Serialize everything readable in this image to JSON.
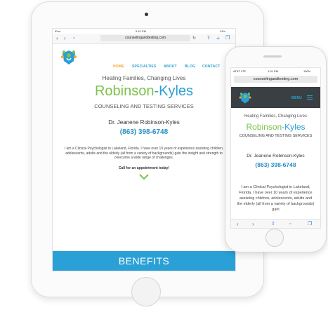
{
  "colors": {
    "green": "#7cc24a",
    "blue": "#2a9fd3",
    "nav_active": "#f3a533",
    "benefits_bg": "#2aa0d6",
    "phone_nav_bg": "#3a3f44"
  },
  "tablet": {
    "status": {
      "carrier": "iPad",
      "time": "5:10 PM",
      "battery": "34%"
    },
    "url": "counselingandtesting.com",
    "nav": [
      "HOME",
      "SPECIALTIES",
      "ABOUT",
      "BLOG",
      "CONTACT"
    ],
    "tagline": "Healing Families, Changing Lives",
    "name_first": "Robinson",
    "name_sep": "-",
    "name_last": "Kyles",
    "subtitle": "COUNSELING AND TESTING SERVICES",
    "doctor": "Dr. Jeanene Robinson-Kyles",
    "phone": "(863) 398-6748",
    "paragraph": "I am a Clinical Psychologist in Lakeland, Florida. I have over 10 years of experience assisting children, adolescents, adults and the elderly (all from a variety of backgrounds) gain the insight and strength to overcome a wide range of challenges.",
    "call_to_action": "Call for an appointment today!",
    "benefits": "BENEFITS"
  },
  "phone": {
    "status": {
      "carrier": "AT&T LTE",
      "time": "1:31 PM",
      "battery": "100%"
    },
    "url": "counselingandtesting.com",
    "menu_label": "MENU",
    "tagline": "Healing Families, Changing Lives",
    "name_first": "Robinson",
    "name_sep": "-",
    "name_last": "Kyles",
    "subtitle": "COUNSELING AND TESTING SERVICES",
    "doctor": "Dr. Jeanene Robinson-Kyles",
    "phone": "(863) 398-6748",
    "paragraph": "I am a Clinical Psychologist in Lakeland, Florida. I have over 10 years of experience assisting children, adolescents, adults and the elderly (all from a variety of backgrounds) gain"
  }
}
